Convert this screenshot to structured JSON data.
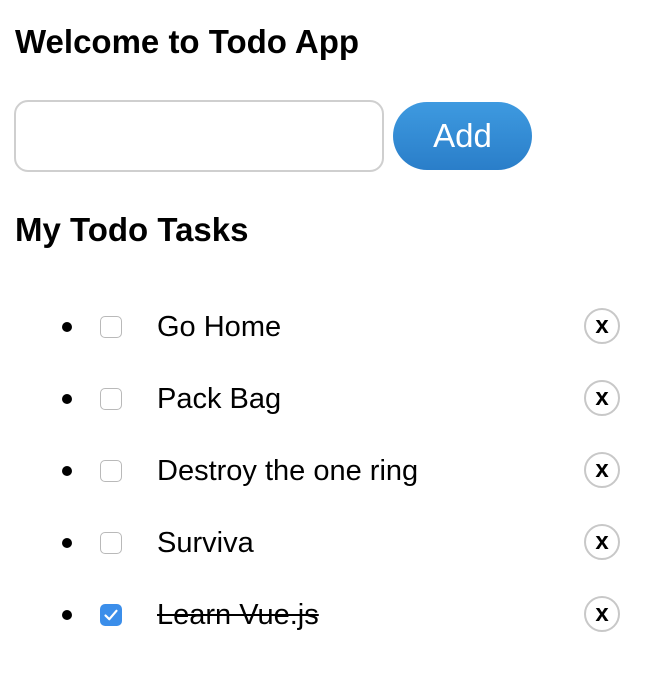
{
  "app": {
    "title": "Welcome to Todo App"
  },
  "add_form": {
    "input_value": "",
    "input_placeholder": "",
    "add_label": "Add"
  },
  "tasks_section": {
    "title": "My Todo Tasks"
  },
  "tasks": [
    {
      "text": "Go Home",
      "done": false,
      "delete_label": "x"
    },
    {
      "text": "Pack Bag",
      "done": false,
      "delete_label": "x"
    },
    {
      "text": "Destroy the one ring",
      "done": false,
      "delete_label": "x"
    },
    {
      "text": "Surviva",
      "done": false,
      "delete_label": "x"
    },
    {
      "text": "Learn Vue.js",
      "done": true,
      "delete_label": "x"
    }
  ],
  "colors": {
    "accent": "#3b8eea",
    "add_button_top": "#3e9ae0",
    "add_button_bottom": "#2a7ec9",
    "border": "#cfcfcf"
  },
  "icons": {
    "check": "checkmark-icon",
    "bullet": "bullet-dot-icon"
  }
}
